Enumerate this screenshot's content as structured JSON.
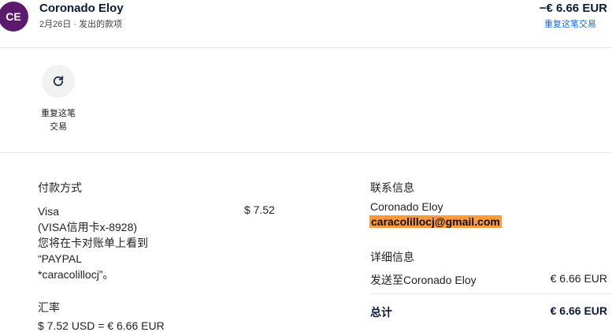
{
  "header": {
    "avatar_initials": "CE",
    "name": "Coronado Eloy",
    "subtitle": "2月26日 · 发出的款项",
    "amount": "−€ 6.66 EUR",
    "repeat_link": "重复这笔交易"
  },
  "action": {
    "icon": "refresh-icon",
    "label_line1": "重复这笔",
    "label_line2": "交易"
  },
  "payment": {
    "title": "付款方式",
    "lines": [
      "Visa",
      "(VISA信用卡x-8928)",
      "您将在卡对账单上看到",
      "“PAYPAL",
      "*caracolillocj”。"
    ],
    "amount": "$ 7.52"
  },
  "exchange": {
    "title": "汇率",
    "partial_text": "$ 7.52 USD = € 6.66 EUR"
  },
  "contact": {
    "title": "联系信息",
    "name": "Coronado Eloy",
    "email": "caracolillocj@gmail.com"
  },
  "details": {
    "title": "详细信息",
    "rows": [
      {
        "label": "发送至Coronado Eloy",
        "value": "€ 6.66 EUR"
      },
      {
        "label": "总计",
        "value": "€ 6.66 EUR"
      }
    ]
  },
  "colors": {
    "avatar": "#5b1a6b",
    "link": "#1a66d2",
    "highlight": "#ff9a3c"
  }
}
